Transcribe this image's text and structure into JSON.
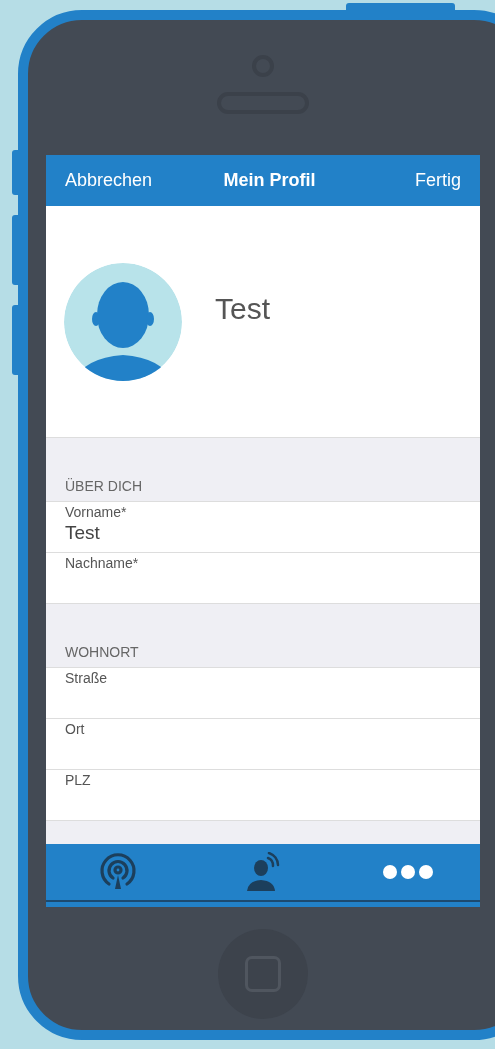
{
  "nav_bar": {
    "left_button": "Abbrechen",
    "title": "Mein Profil",
    "right_button": "Fertig"
  },
  "profile": {
    "name": "Test"
  },
  "sections": [
    {
      "header": "ÜBER DICH",
      "fields": [
        {
          "label": "Vorname*",
          "value": "Test"
        },
        {
          "label": "Nachname*"
        }
      ]
    },
    {
      "header": "WOHNORT",
      "fields": [
        {
          "label": "Straße"
        },
        {
          "label": "Ort"
        },
        {
          "label": "PLZ"
        }
      ]
    }
  ],
  "tab_bar": [
    {
      "kind": "broadcast",
      "selected": false
    },
    {
      "kind": "person",
      "selected": false
    },
    {
      "kind": "more",
      "selected": true
    }
  ]
}
